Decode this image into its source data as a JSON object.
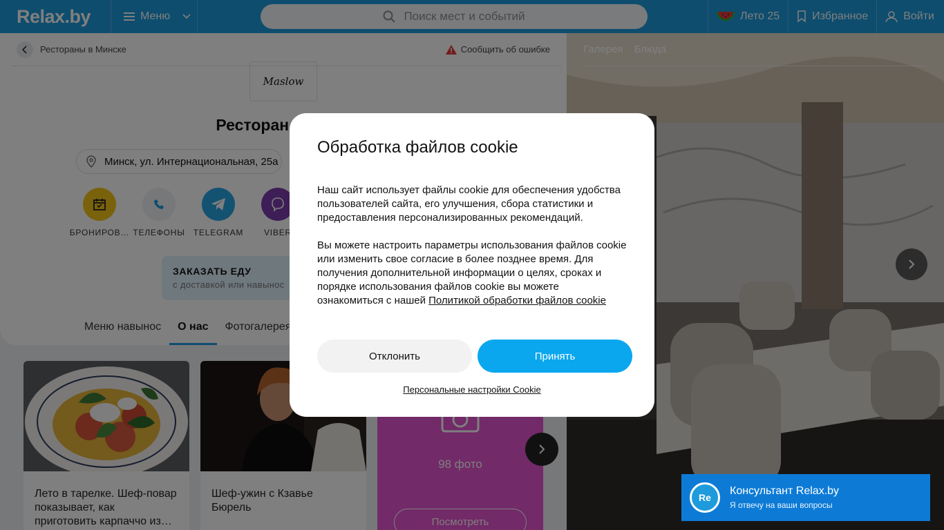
{
  "header": {
    "logo": "Relax.by",
    "menu_label": "Меню",
    "search_placeholder": "Поиск мест и событий",
    "summer_label": "Лето 25",
    "favorites_label": "Избранное",
    "login_label": "Войти"
  },
  "breadcrumb": {
    "back_label": "Рестораны в Минске",
    "report_label": "Сообщить об ошибке"
  },
  "venue": {
    "logo_text": "Maslow",
    "title": "Ресторан Maslow",
    "address": "Минск, ул. Интернациональная, 25а",
    "actions": [
      {
        "label": "БРОНИРОВ…",
        "color": "#f5c518"
      },
      {
        "label": "ТЕЛЕФОНЫ",
        "color": "#eef0f2"
      },
      {
        "label": "TELEGRAM",
        "color": "#29a5e4"
      },
      {
        "label": "VIBER",
        "color": "#7d3daf"
      }
    ],
    "order": {
      "title": "ЗАКАЗАТЬ ЕДУ",
      "subtitle": "с доставкой или навынос"
    },
    "tabs": [
      "Меню навынос",
      "О нас",
      "Фотогалерея"
    ],
    "active_tab": "О нас"
  },
  "cards": [
    {
      "text": "Лето в тарелке. Шеф-повар показывает, как приготовить карпаччо из…"
    },
    {
      "text": "Шеф-ужин с Кзавье Бюрель"
    }
  ],
  "photo_card": {
    "count": "98 фото",
    "button": "Посмотреть"
  },
  "gallery": {
    "tabs": [
      "Галерея",
      "Блюда"
    ]
  },
  "consultant": {
    "avatar": "Re",
    "title": "Консультант Relax.by",
    "subtitle": "Я отвечу на ваши вопросы"
  },
  "cookie_modal": {
    "title": "Обработка файлов cookie",
    "paragraph1": "Наш сайт использует файлы cookie для обеспечения удобства пользователей сайта, его улучшения, сбора статистики и предоставления персонализированных рекомендаций.",
    "paragraph2": "Вы можете настроить параметры использования файлов cookie или изменить свое согласие в более позднее время. Для получения дополнительной информации о целях, сроках и порядке использования файлов cookie вы можете ознакомиться с нашей",
    "policy_link": "Политикой обработки файлов cookie",
    "decline_label": "Отклонить",
    "accept_label": "Принять",
    "personal_settings": "Персональные настройки Cookie"
  },
  "colors": {
    "brand": "#1d9bdc",
    "accept": "#0aa7ee",
    "photo_card": "#e455d0"
  }
}
